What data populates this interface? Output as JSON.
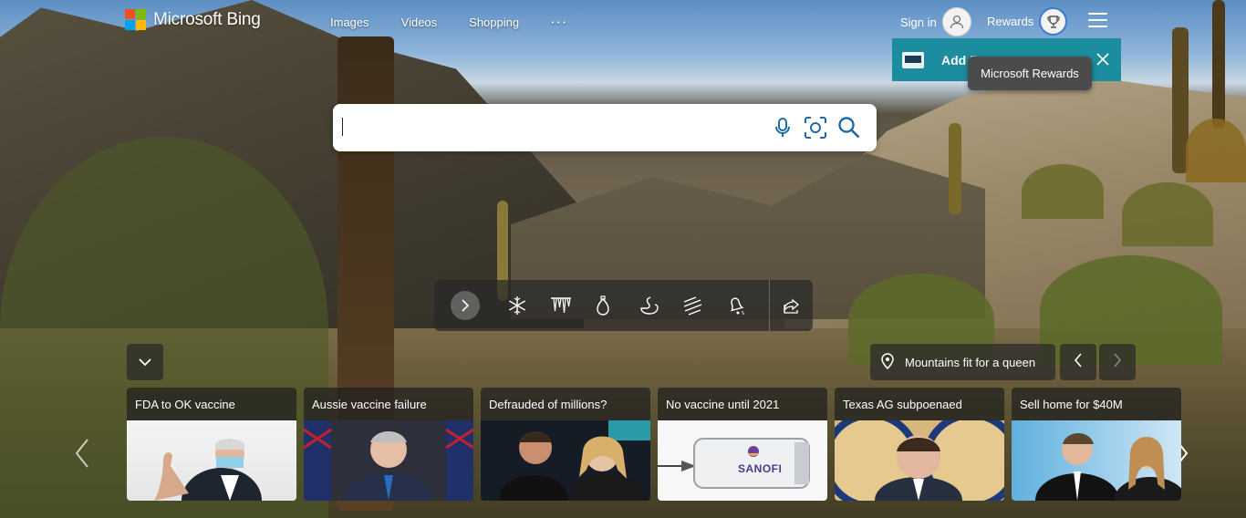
{
  "brand": {
    "name": "Microsoft Bing",
    "logo_colors": [
      "#f25022",
      "#7fba00",
      "#00a4ef",
      "#ffb900"
    ]
  },
  "nav": {
    "items": [
      "Images",
      "Videos",
      "Shopping"
    ],
    "more_label": "···"
  },
  "account": {
    "signin_label": "Sign in",
    "rewards_label": "Rewards",
    "avatar_icon": "person-icon",
    "rewards_icon": "trophy-icon",
    "menu_icon": "hamburger-icon"
  },
  "notification": {
    "text": "Add B",
    "close_icon": "close-icon",
    "color": "#1b8d9e"
  },
  "tooltip": {
    "text": "Microsoft Rewards"
  },
  "search": {
    "value": "",
    "placeholder": "",
    "icons": [
      "microphone-icon",
      "visual-search-icon",
      "search-icon"
    ],
    "accent": "#1e6aa8"
  },
  "actionbar": {
    "next_icon": "chevron-right-icon",
    "quiz_icons": [
      "snowflake-icon",
      "icicles-icon",
      "ornament-icon",
      "swan-icon",
      "stripes-icon",
      "bell-icon"
    ],
    "share_icon": "share-icon"
  },
  "image_info": {
    "collapse_icon": "chevron-down-icon",
    "location_icon": "location-pin-icon",
    "caption": "Mountains fit for a queen",
    "prev_icon": "chevron-left-icon",
    "next_icon": "chevron-right-icon"
  },
  "news": {
    "cards": [
      {
        "title": "FDA to OK vaccine"
      },
      {
        "title": "Aussie vaccine failure"
      },
      {
        "title": "Defrauded of millions?"
      },
      {
        "title": "No vaccine until 2021"
      },
      {
        "title": "Texas AG subpoenaed"
      },
      {
        "title": "Sell home for $40M"
      }
    ],
    "image_texts": {
      "sanofi": "SANOFI"
    },
    "scroll_left_icon": "chevron-left-icon",
    "scroll_right_icon": "chevron-right-icon"
  }
}
